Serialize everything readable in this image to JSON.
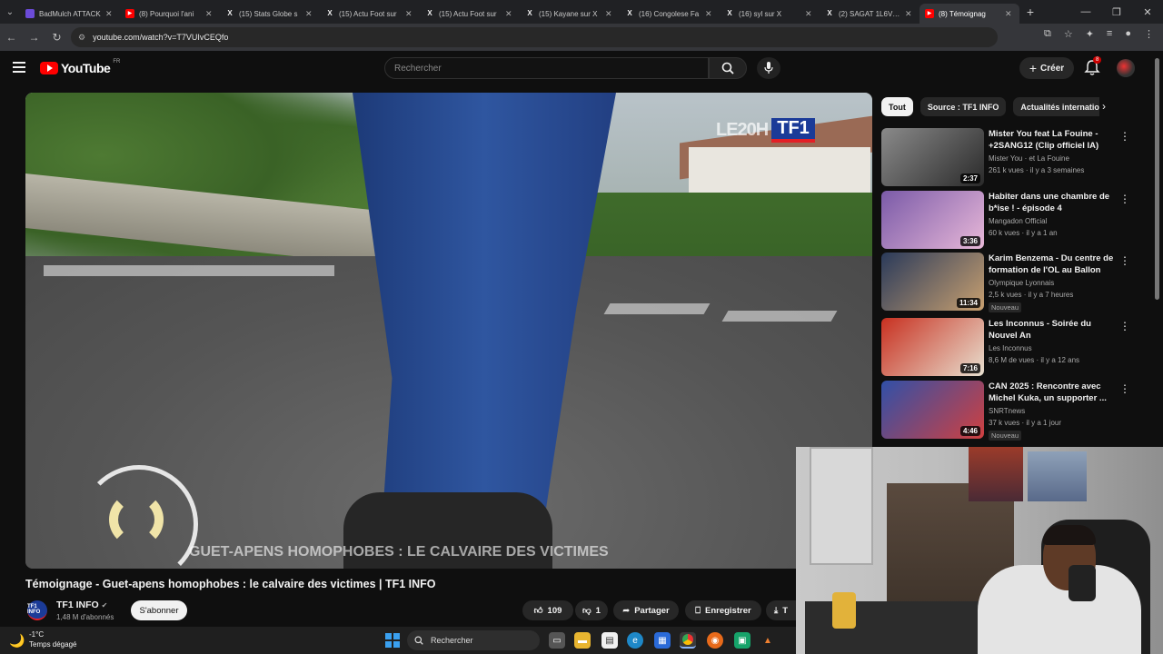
{
  "browser": {
    "tabs": [
      {
        "label": "BadMulch ATTACK",
        "icon": "purple-square-icon",
        "color": "#6b4bd8"
      },
      {
        "label": "(8) Pourquoi l'ani",
        "icon": "youtube-icon",
        "color": "#ff0000"
      },
      {
        "label": "(15) Stats Globe s",
        "icon": "x-icon",
        "color": "#000000"
      },
      {
        "label": "(15) Actu Foot sur",
        "icon": "x-icon",
        "color": "#000000"
      },
      {
        "label": "(15) Actu Foot sur",
        "icon": "x-icon",
        "color": "#000000"
      },
      {
        "label": "(15) Kayane sur X",
        "icon": "x-icon",
        "color": "#000000"
      },
      {
        "label": "(16) Congolese Fa",
        "icon": "x-icon",
        "color": "#000000"
      },
      {
        "label": "(16) syl sur X",
        "icon": "x-icon",
        "color": "#000000"
      },
      {
        "label": "(2) SAGAT 1L6VTF",
        "icon": "x-icon",
        "color": "#000000"
      },
      {
        "label": "(8) Témoignag",
        "icon": "youtube-icon",
        "color": "#ff0000",
        "active": true
      }
    ],
    "url": "youtube.com/watch?v=T7VUIvCEQfo"
  },
  "youtube": {
    "logo_text": "YouTube",
    "country": "FR",
    "search_placeholder": "Rechercher",
    "create_label": "Créer",
    "notification_count": "8"
  },
  "video": {
    "overlay_logo_left": "LE20H",
    "overlay_logo_right": "TF1",
    "caption": "GUET-APENS HOMOPHOBES : LE CALVAIRE DES VICTIMES",
    "title": "Témoignage - Guet-apens homophobes : le calvaire des victimes | TF1 INFO",
    "channel_avatar_text": "TF1 INFO",
    "channel_name": "TF1 INFO",
    "subscribers": "1,48 M d'abonnés",
    "subscribe_label": "S'abonner",
    "likes": "109",
    "dislikes": "1",
    "share_label": "Partager",
    "save_label": "Enregistrer",
    "download_label": "T"
  },
  "sidebar": {
    "chips": [
      "Tout",
      "Source : TF1 INFO",
      "Actualités internation"
    ],
    "recommendations": [
      {
        "title": "Mister You feat La Fouine - +2SANG12 (Clip officiel IA)",
        "channel": "Mister You · et La Fouine",
        "meta": "261 k vues · il y a 3 semaines",
        "duration": "2:37",
        "badge": "",
        "colors": [
          "#8a8a8a",
          "#2a2a2a"
        ]
      },
      {
        "title": "Habiter dans une chambre de b*ise ! - épisode 4",
        "channel": "Mangadon Official",
        "meta": "60 k vues · il y a 1 an",
        "duration": "3:36",
        "badge": "",
        "colors": [
          "#7a5aa8",
          "#e8b8d8"
        ]
      },
      {
        "title": "Karim Benzema - Du centre de formation de l'OL au Ballon d'...",
        "channel": "Olympique Lyonnais",
        "meta": "2,5 k vues · il y a 7 heures",
        "duration": "11:34",
        "badge": "Nouveau",
        "colors": [
          "#2a3a5a",
          "#c8a070"
        ]
      },
      {
        "title": "Les Inconnus - Soirée du Nouvel An",
        "channel": "Les Inconnus",
        "meta": "8,6 M de vues · il y a 12 ans",
        "duration": "7:16",
        "badge": "",
        "colors": [
          "#c83020",
          "#e8e0d0"
        ]
      },
      {
        "title": "CAN 2025 : Rencontre avec Michel Kuka, un supporter ...",
        "channel": "SNRTnews",
        "meta": "37 k vues · il y a 1 jour",
        "duration": "4:46",
        "badge": "Nouveau",
        "colors": [
          "#3050a8",
          "#d04040"
        ]
      }
    ]
  },
  "taskbar": {
    "temperature": "-1°C",
    "weather": "Temps dégagé",
    "search_label": "Rechercher"
  }
}
